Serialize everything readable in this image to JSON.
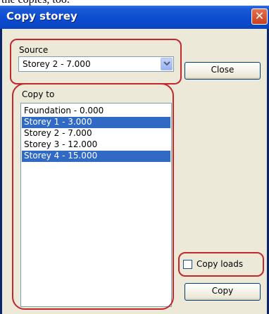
{
  "background_text": "the copies, too.",
  "window": {
    "title": "Copy storey",
    "close_glyph": "✕"
  },
  "source": {
    "label": "Source",
    "selected_value": "Storey 2 - 7.000"
  },
  "close_button": {
    "label": "Close"
  },
  "copy_to": {
    "label": "Copy to",
    "items": [
      {
        "label": "Foundation - 0.000",
        "selected": false
      },
      {
        "label": "Storey 1 - 3.000",
        "selected": true
      },
      {
        "label": "Storey 2 - 7.000",
        "selected": false
      },
      {
        "label": "Storey 3 - 12.000",
        "selected": false
      },
      {
        "label": "Storey 4 - 15.000",
        "selected": true
      }
    ]
  },
  "copy_loads": {
    "label": "Copy loads",
    "checked": false
  },
  "copy_button": {
    "label": "Copy"
  },
  "colors": {
    "annotation": "#c1272d",
    "selection": "#316ac5",
    "titlebar": "#0a4bd0",
    "dialog_bg": "#ece9d8"
  },
  "icons": [
    "close-icon",
    "chevron-down-icon"
  ]
}
